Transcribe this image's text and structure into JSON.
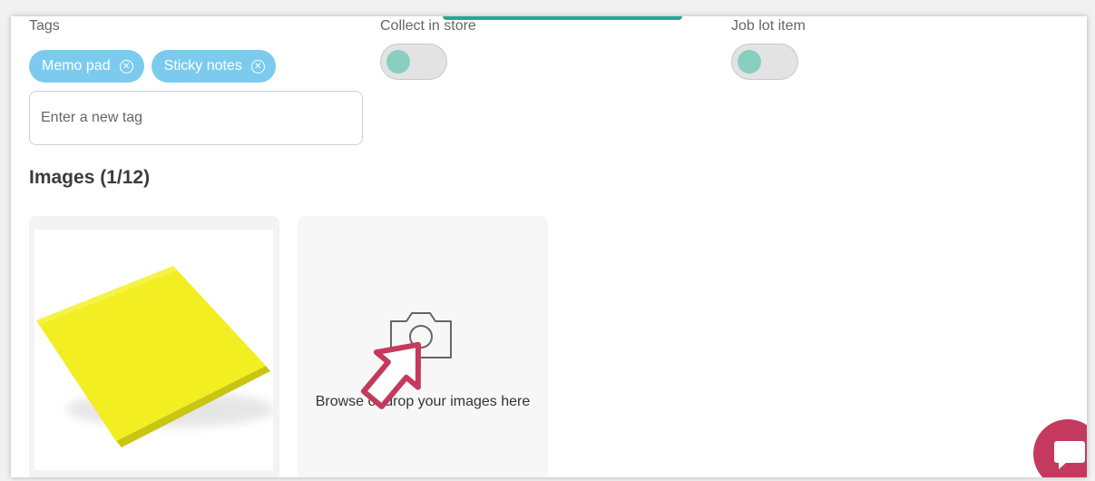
{
  "tags": {
    "label": "Tags",
    "items": [
      "Memo pad",
      "Sticky notes"
    ],
    "input_placeholder": "Enter a new tag"
  },
  "collect_in_store": {
    "label": "Collect in store",
    "enabled": false
  },
  "job_lot_item": {
    "label": "Job lot item",
    "enabled": false
  },
  "images": {
    "title": "Images (1/12)",
    "upload_text": "Browse or drop your images here"
  },
  "colors": {
    "tag_background": "#7ccbee",
    "toggle_knob": "#88cfc0",
    "accent_strip": "#23a893",
    "chat_button": "#c43a5e",
    "cursor": "#c43a5e",
    "sticky_note": "#f2ee21"
  },
  "icons": [
    "remove-tag-icon",
    "camera-icon",
    "pointer-cursor-icon",
    "chat-bubble-icon"
  ]
}
